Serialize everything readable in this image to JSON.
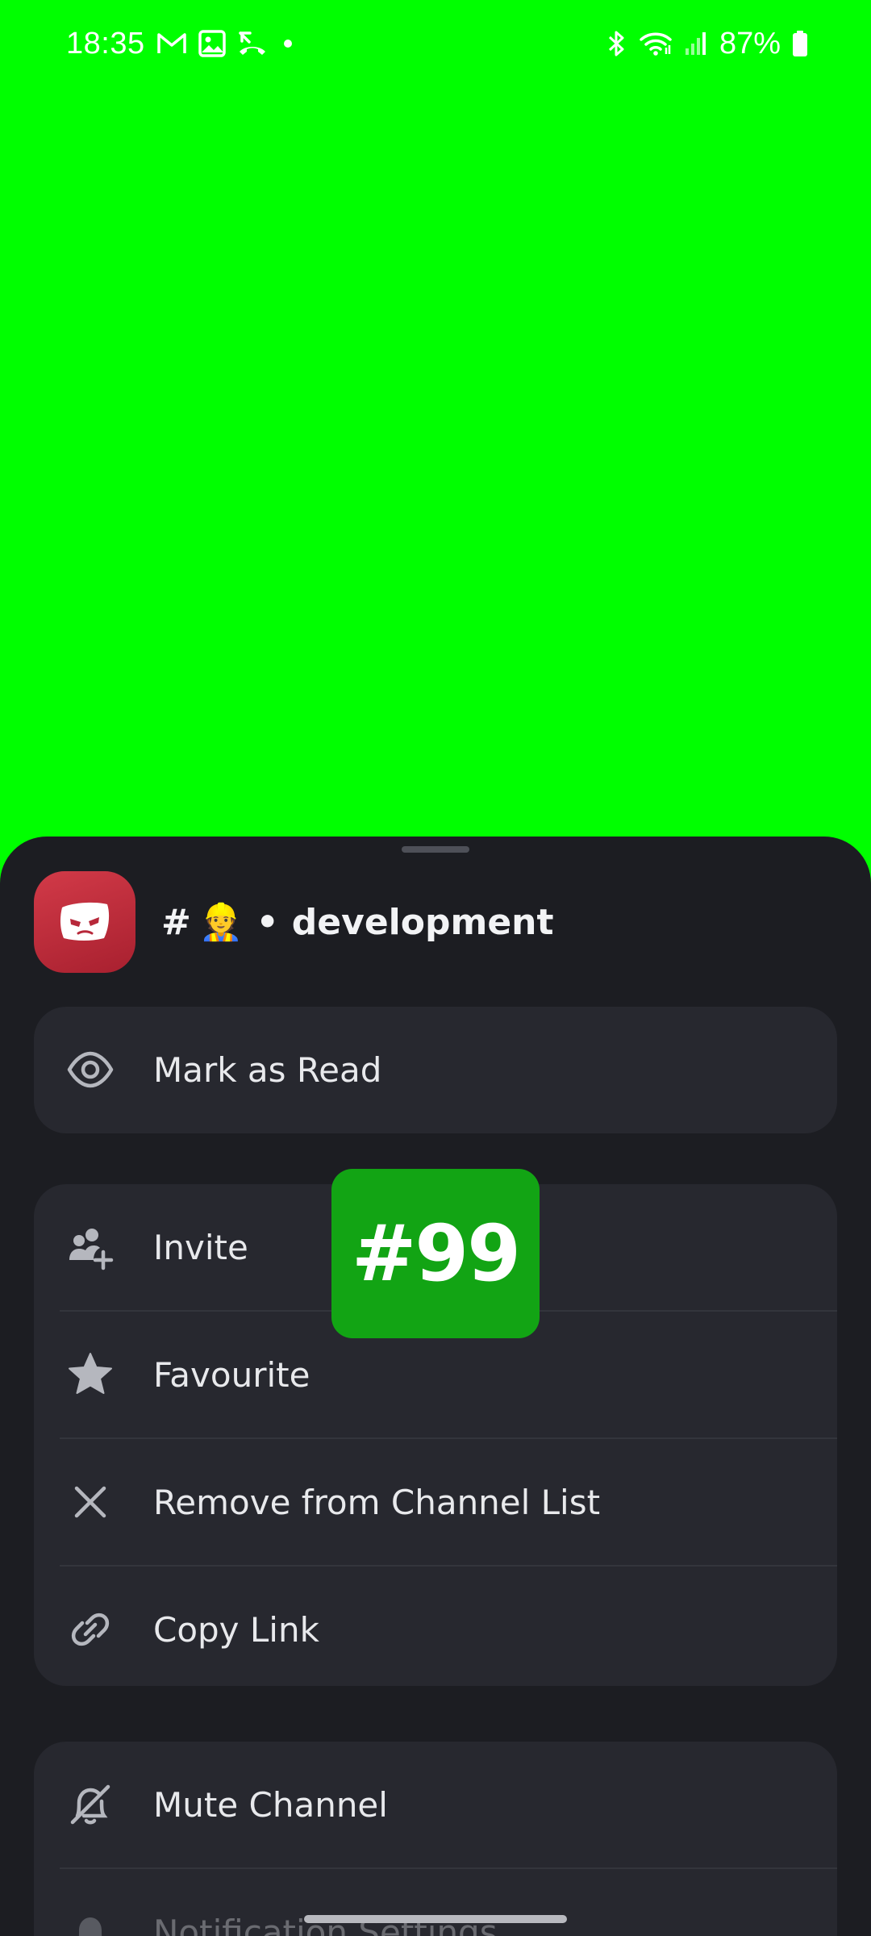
{
  "status_bar": {
    "time": "18:35",
    "battery": "87%",
    "icons_left": [
      "gmail-icon",
      "gallery-icon",
      "missed-call-icon",
      "dot-icon"
    ],
    "icons_right": [
      "bluetooth-icon",
      "wifi-icon",
      "signal-icon",
      "battery-icon"
    ]
  },
  "sheet": {
    "server_icon": "server-logo-icon",
    "channel": {
      "prefix": "#",
      "emoji": "👷",
      "separator": "•",
      "name": "development"
    },
    "groups": [
      {
        "items": [
          {
            "label": "Mark as Read",
            "icon": "eye-icon"
          }
        ]
      },
      {
        "items": [
          {
            "label": "Invite",
            "icon": "add-user-icon"
          },
          {
            "label": "Favourite",
            "icon": "star-icon"
          },
          {
            "label": "Remove from Channel List",
            "icon": "close-icon"
          },
          {
            "label": "Copy Link",
            "icon": "link-icon"
          }
        ]
      },
      {
        "items": [
          {
            "label": "Mute Channel",
            "icon": "bell-muted-icon"
          },
          {
            "label": "Notification Settings",
            "icon": "bell-icon"
          }
        ]
      }
    ]
  },
  "overlay_badge": {
    "text": "#99"
  },
  "colors": {
    "background": "#00ff00",
    "sheet": "#1c1d22",
    "group": "#27282f",
    "server_avatar": "#c0303f",
    "badge": "#12a414"
  }
}
